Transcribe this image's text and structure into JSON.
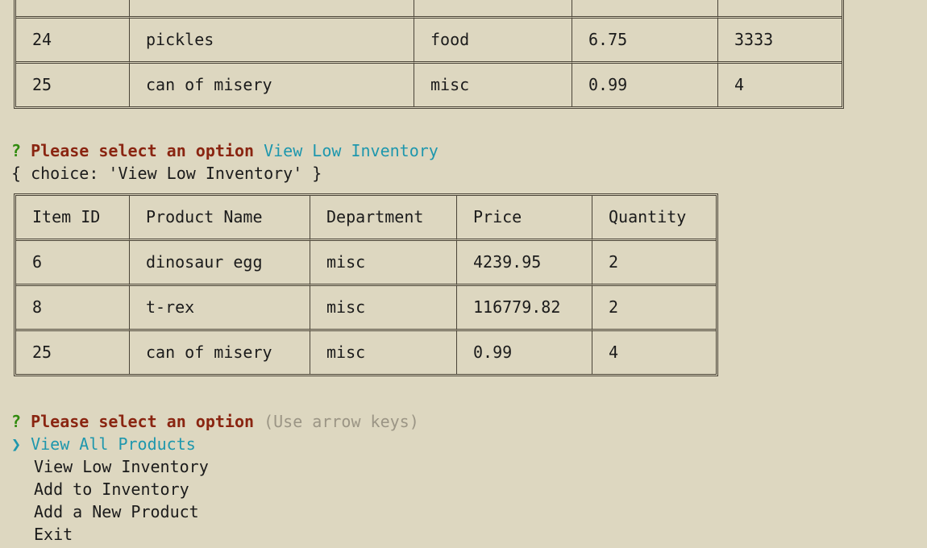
{
  "top_table": {
    "rows": [
      [
        "24",
        "pickles",
        "food",
        "6.75",
        "3333"
      ],
      [
        "25",
        "can of misery",
        "misc",
        "0.99",
        "4"
      ]
    ]
  },
  "first_prompt": {
    "marker": "?",
    "question": "Please select an option",
    "answer": "View Low Inventory",
    "echo": "{ choice: 'View Low Inventory' }"
  },
  "low_table": {
    "headers": [
      "Item ID",
      "Product Name",
      "Department",
      "Price",
      "Quantity"
    ],
    "rows": [
      [
        "6",
        "dinosaur egg",
        "misc",
        "4239.95",
        "2"
      ],
      [
        "8",
        "t-rex",
        "misc",
        "116779.82",
        "2"
      ],
      [
        "25",
        "can of misery",
        "misc",
        "0.99",
        "4"
      ]
    ]
  },
  "second_prompt": {
    "marker": "?",
    "question": "Please select an option",
    "hint": "(Use arrow keys)",
    "pointer": "❯",
    "options": [
      "View All Products",
      "View Low Inventory",
      "Add to Inventory",
      "Add a New Product",
      "Exit"
    ]
  },
  "colors": {
    "background": "#ddd7c0",
    "question_marker": "#2f8a0c",
    "prompt_text": "#8a2511",
    "selected": "#1e97ad",
    "hint": "#9b9585"
  }
}
